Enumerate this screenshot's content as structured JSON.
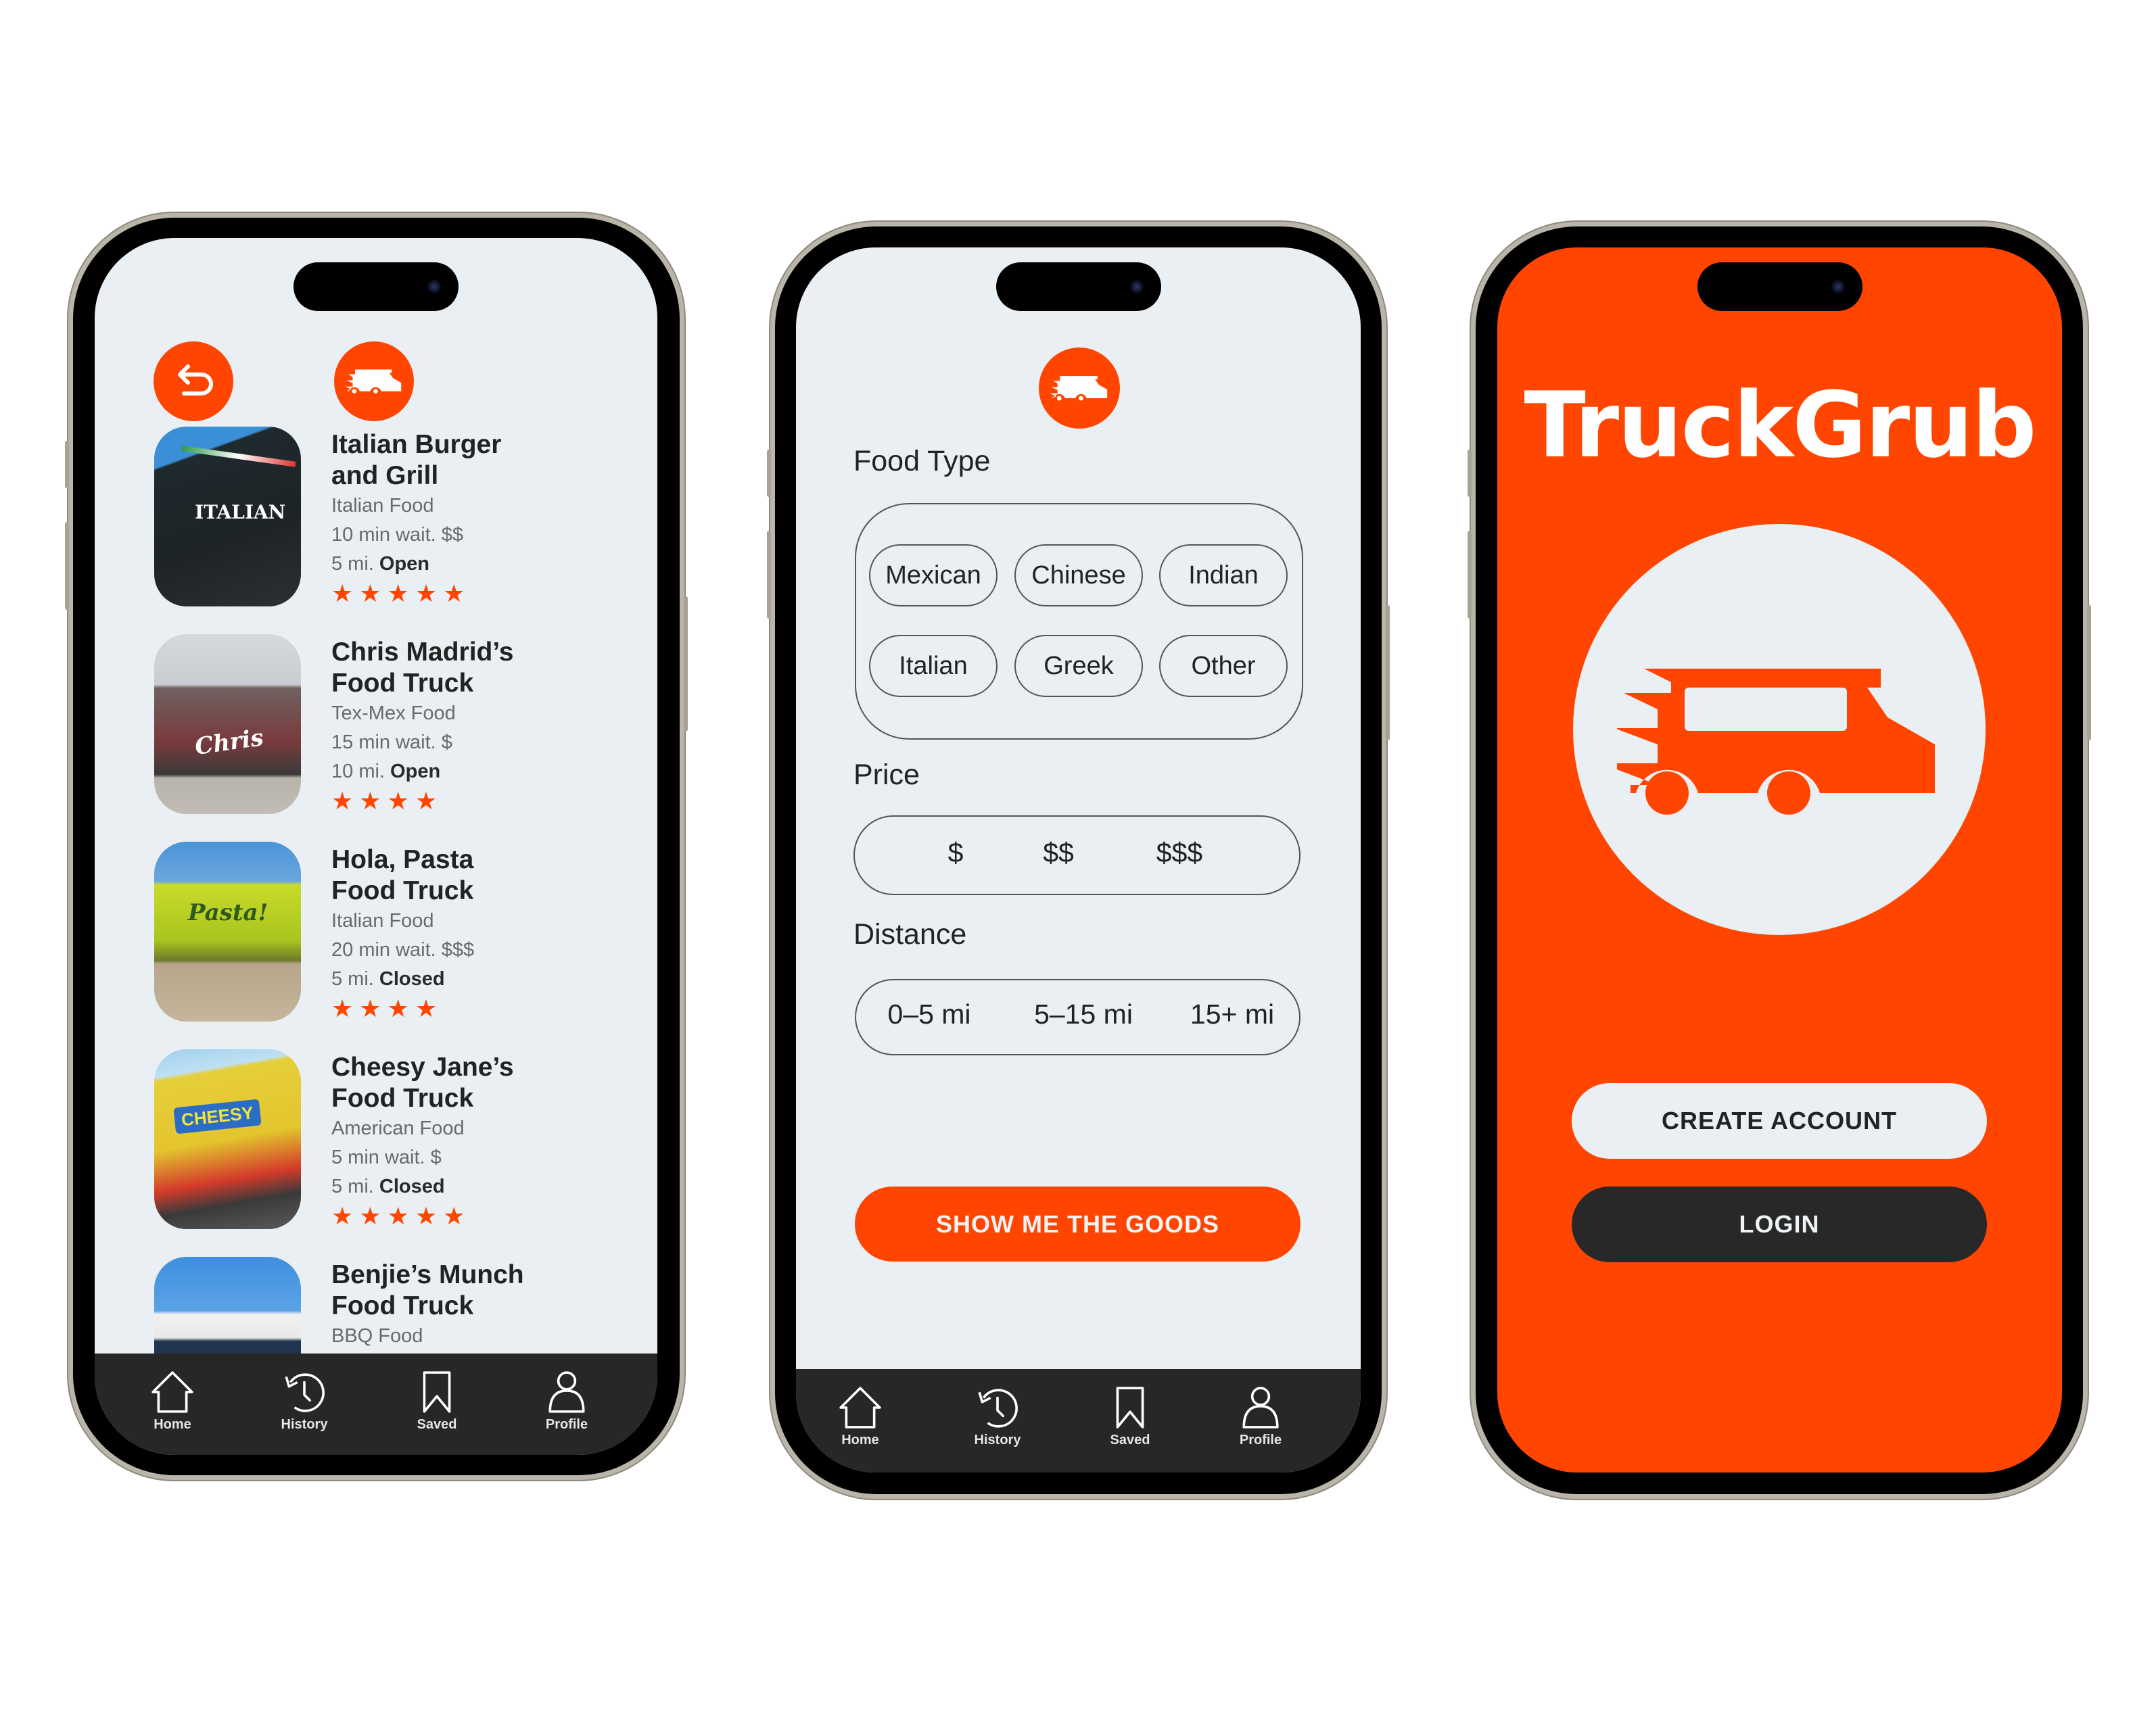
{
  "colors": {
    "accent": "#ff4500",
    "dark": "#272727",
    "screen_bg": "#e9eff2"
  },
  "list_screen": {
    "back_icon": "undo-arrow-icon",
    "filter_icon": "food-truck-icon",
    "trucks": [
      {
        "name_line1": "Italian Burger",
        "name_line2": "and Grill",
        "category": "Italian Food",
        "wait": "10 min wait. $$",
        "distance": "5 mi.",
        "status": "Open",
        "rating": 5,
        "stars": "★★★★★",
        "photo": "Italian burger & grill truck photo"
      },
      {
        "name_line1": "Chris Madrid’s",
        "name_line2": "Food Truck",
        "category": "Tex-Mex Food",
        "wait": "15 min wait. $",
        "distance": "10 mi.",
        "status": "Open",
        "rating": 4,
        "stars": "★★★★",
        "photo": "Chris Madrid's truck photo"
      },
      {
        "name_line1": "Hola, Pasta",
        "name_line2": "Food Truck",
        "category": "Italian Food",
        "wait": "20 min wait. $$$",
        "distance": "5 mi.",
        "status": "Closed",
        "rating": 4,
        "stars": "★★★★",
        "photo": "Hola Pasta truck photo"
      },
      {
        "name_line1": "Cheesy Jane’s",
        "name_line2": "Food Truck",
        "category": "American Food",
        "wait": "5 min wait. $",
        "distance": "5 mi.",
        "status": "Closed",
        "rating": 5,
        "stars": "★★★★★",
        "photo": "Cheesy Jane's truck photo"
      },
      {
        "name_line1": "Benjie’s Munch",
        "name_line2": "Food Truck",
        "category": "BBQ Food",
        "wait": "",
        "distance": "",
        "status": "",
        "rating": null,
        "stars": "",
        "photo": "Benjie's Munch truck photo"
      }
    ]
  },
  "filter_screen": {
    "header_icon": "food-truck-icon",
    "food_type_label": "Food Type",
    "food_types": [
      "Mexican",
      "Chinese",
      "Indian",
      "Italian",
      "Greek",
      "Other"
    ],
    "price_label": "Price",
    "prices": [
      "$",
      "$$",
      "$$$"
    ],
    "distance_label": "Distance",
    "distances": [
      "0–5 mi",
      "5–15 mi",
      "15+ mi"
    ],
    "submit_label": "SHOW ME THE GOODS"
  },
  "nav": [
    {
      "label": "Home",
      "icon": "home-icon"
    },
    {
      "label": "History",
      "icon": "history-icon"
    },
    {
      "label": "Saved",
      "icon": "bookmark-icon"
    },
    {
      "label": "Profile",
      "icon": "profile-icon"
    }
  ],
  "welcome_screen": {
    "app_title": "TruckGrub",
    "logo_icon": "food-truck-icon",
    "create_account_label": "CREATE ACCOUNT",
    "login_label": "LOGIN"
  }
}
